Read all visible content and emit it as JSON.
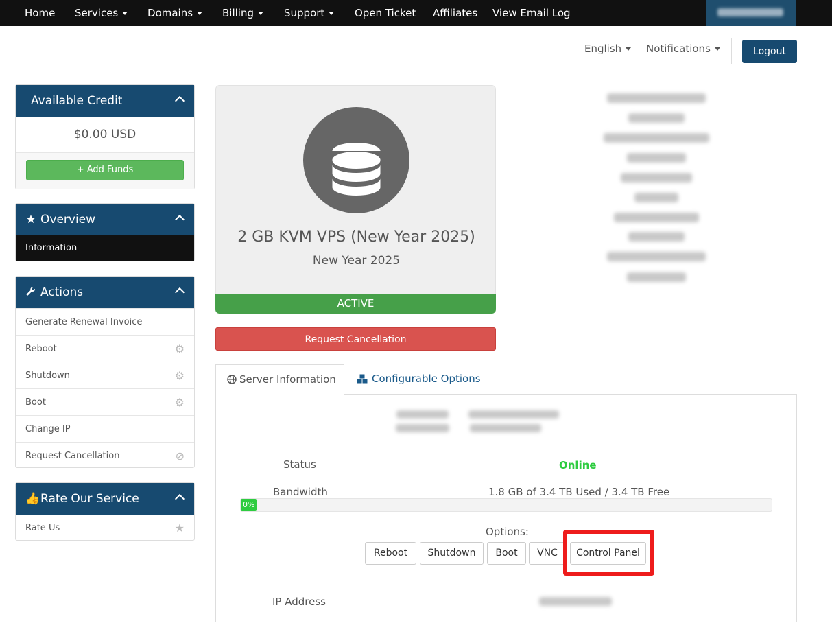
{
  "nav": {
    "home": "Home",
    "services": "Services",
    "domains": "Domains",
    "billing": "Billing",
    "support": "Support",
    "open_ticket": "Open Ticket",
    "affiliates": "Affiliates",
    "email_log": "View Email Log"
  },
  "header": {
    "language": "English",
    "notifications": "Notifications",
    "logout": "Logout"
  },
  "sidebar": {
    "credit": {
      "title": "Available Credit",
      "amount": "$0.00 USD",
      "add_funds": "Add Funds"
    },
    "overview": {
      "title": "Overview",
      "items": [
        {
          "label": "Information"
        }
      ]
    },
    "actions": {
      "title": "Actions",
      "items": [
        {
          "label": "Generate Renewal Invoice",
          "icon": ""
        },
        {
          "label": "Reboot",
          "icon": "gears-icon"
        },
        {
          "label": "Shutdown",
          "icon": "gears-icon"
        },
        {
          "label": "Boot",
          "icon": "gears-icon"
        },
        {
          "label": "Change IP",
          "icon": ""
        },
        {
          "label": "Request Cancellation",
          "icon": "ban-icon"
        }
      ]
    },
    "rate": {
      "title": "Rate Our Service",
      "items": [
        {
          "label": "Rate Us",
          "icon": "star-icon"
        }
      ]
    }
  },
  "product": {
    "name": "2 GB KVM VPS (New Year 2025)",
    "group": "New Year 2025",
    "status": "ACTIVE",
    "cancel_button": "Request Cancellation",
    "icon": "database-icon"
  },
  "tabs": {
    "server_info": "Server Information",
    "configurable_options": "Configurable Options"
  },
  "server": {
    "status_label": "Status",
    "status_value": "Online",
    "bandwidth_label": "Bandwidth",
    "bandwidth_value": "1.8 GB of 3.4 TB Used / 3.4 TB Free",
    "bandwidth_percent": 0,
    "bandwidth_percent_label": "0%",
    "options_label": "Options:",
    "buttons": {
      "reboot": "Reboot",
      "shutdown": "Shutdown",
      "boot": "Boot",
      "vnc": "VNC",
      "control_panel": "Control Panel"
    },
    "ip_label": "IP Address"
  },
  "colors": {
    "brand": "#174a70",
    "success": "#46a049",
    "danger": "#d9534f",
    "online": "#2ecc40",
    "highlight": "#ee1c1c"
  }
}
